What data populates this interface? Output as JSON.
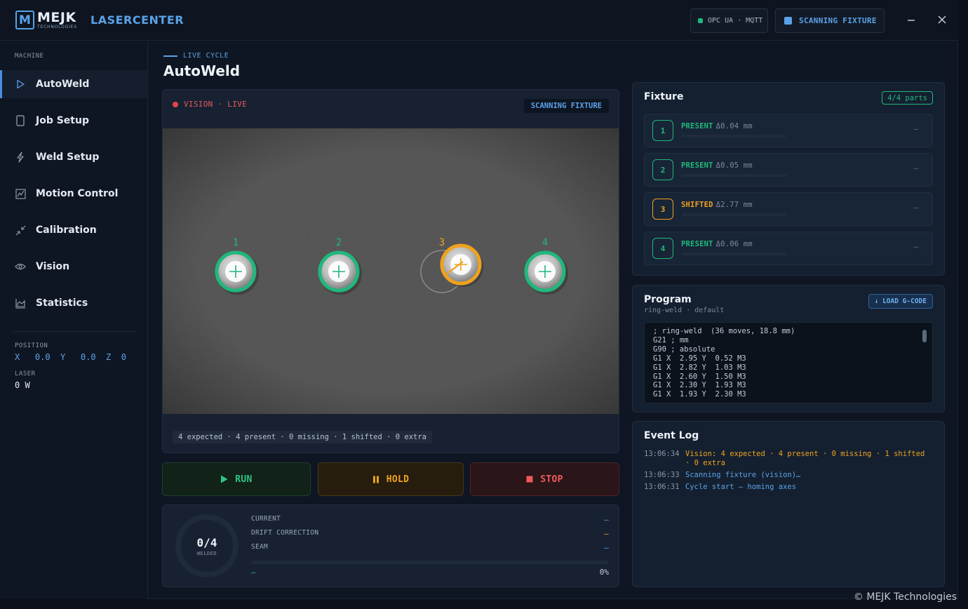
{
  "header": {
    "brand_main": "MEJK",
    "brand_sub": "TECHNOLOGIES",
    "app_title": "LASERCENTER",
    "connection": "OPC UA · MQTT",
    "status": "SCANNING FIXTURE",
    "minimize_icon": "minimize-icon",
    "close_icon": "close-icon"
  },
  "sidebar": {
    "section": "MACHINE",
    "items": [
      {
        "label": "AutoWeld",
        "icon": "play-outline-icon"
      },
      {
        "label": "Job Setup",
        "icon": "document-icon"
      },
      {
        "label": "Weld Setup",
        "icon": "lightning-icon"
      },
      {
        "label": "Motion Control",
        "icon": "motion-chart-icon"
      },
      {
        "label": "Calibration",
        "icon": "calibration-arrows-icon"
      },
      {
        "label": "Vision",
        "icon": "eye-icon"
      },
      {
        "label": "Statistics",
        "icon": "area-chart-icon"
      }
    ],
    "position_label": "POSITION",
    "position_value": "X   0.0  Y   0.0  Z  0",
    "laser_label": "LASER",
    "laser_value": "0 W"
  },
  "main": {
    "eyebrow": "LIVE CYCLE",
    "title": "AutoWeld",
    "vision": {
      "live": "VISION · LIVE",
      "badge": "SCANNING FIXTURE",
      "stats": "4 expected · 4 present · 0 missing · 1 shifted · 0 extra",
      "parts": [
        {
          "label": "1",
          "state": "present"
        },
        {
          "label": "2",
          "state": "present"
        },
        {
          "label": "3",
          "state": "shifted"
        },
        {
          "label": "4",
          "state": "present"
        }
      ]
    },
    "controls": {
      "run": "RUN",
      "hold": "HOLD",
      "stop": "STOP"
    },
    "progress": {
      "count": "0/4",
      "count_label": "WELDED",
      "current_label": "CURRENT",
      "current_value": "—",
      "drift_label": "DRIFT CORRECTION",
      "drift_value": "—",
      "seam_label": "SEAM",
      "seam_value": "—",
      "foot_left": "—",
      "percent": "0%",
      "fraction": 0
    }
  },
  "fixture": {
    "title": "Fixture",
    "badge": "4/4 parts",
    "rows": [
      {
        "num": "1",
        "status": "PRESENT",
        "delta": "Δ0.04 mm",
        "dash": "—"
      },
      {
        "num": "2",
        "status": "PRESENT",
        "delta": "Δ0.05 mm",
        "dash": "—"
      },
      {
        "num": "3",
        "status": "SHIFTED",
        "delta": "Δ2.77 mm",
        "dash": "—"
      },
      {
        "num": "4",
        "status": "PRESENT",
        "delta": "Δ0.06 mm",
        "dash": "—"
      }
    ]
  },
  "program": {
    "title": "Program",
    "subtitle": "ring-weld · default",
    "load": "↓ LOAD G-CODE",
    "lines": [
      "; ring-weld  (36 moves, 18.8 mm)",
      "G21 ; mm",
      "G90 ; absolute",
      "G1 X  2.95 Y  0.52 M3",
      "G1 X  2.82 Y  1.03 M3",
      "G1 X  2.60 Y  1.50 M3",
      "G1 X  2.30 Y  1.93 M3",
      "G1 X  1.93 Y  2.30 M3"
    ]
  },
  "event_log": {
    "title": "Event Log",
    "entries": [
      {
        "time": "13:06:34",
        "msg": "Vision: 4 expected · 4 present · 0 missing · 1 shifted · 0 extra",
        "level": "warn"
      },
      {
        "time": "13:06:33",
        "msg": "Scanning fixture (vision)…",
        "level": "info"
      },
      {
        "time": "13:06:31",
        "msg": "Cycle start — homing axes",
        "level": "info"
      }
    ]
  },
  "footer": {
    "copyright": "© MEJK Technologies"
  },
  "colors": {
    "accent": "#5aa2e8",
    "ok": "#21b77c",
    "warn": "#efa21e",
    "danger": "#f05959"
  }
}
